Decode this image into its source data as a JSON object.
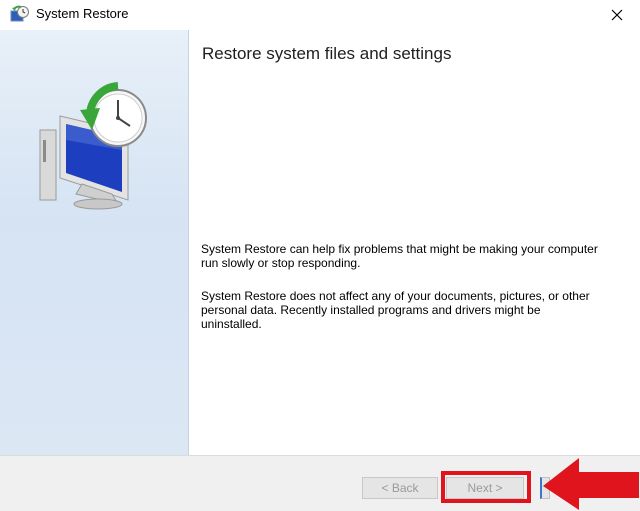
{
  "window": {
    "title": "System Restore"
  },
  "sidebar": {
    "illustration_icon": "system-restore-monitor-clock-icon"
  },
  "main": {
    "heading": "Restore system files and settings",
    "paragraph1": "System Restore can help fix problems that might be making your computer run slowly or stop responding.",
    "paragraph2": "System Restore does not affect any of your documents, pictures, or other personal data. Recently installed programs and drivers might be uninstalled."
  },
  "footer": {
    "back_label": "< Back",
    "next_label": "Next >"
  },
  "annotation": {
    "highlight_color": "#e0141c",
    "arrow_color": "#e0141c",
    "arrow_direction": "left"
  },
  "colors": {
    "sidebar_top": "#e8f0f8",
    "sidebar_bottom": "#d5e3f3",
    "footer_bg": "#f0f0f0",
    "disabled_text": "#9a9a9a"
  }
}
